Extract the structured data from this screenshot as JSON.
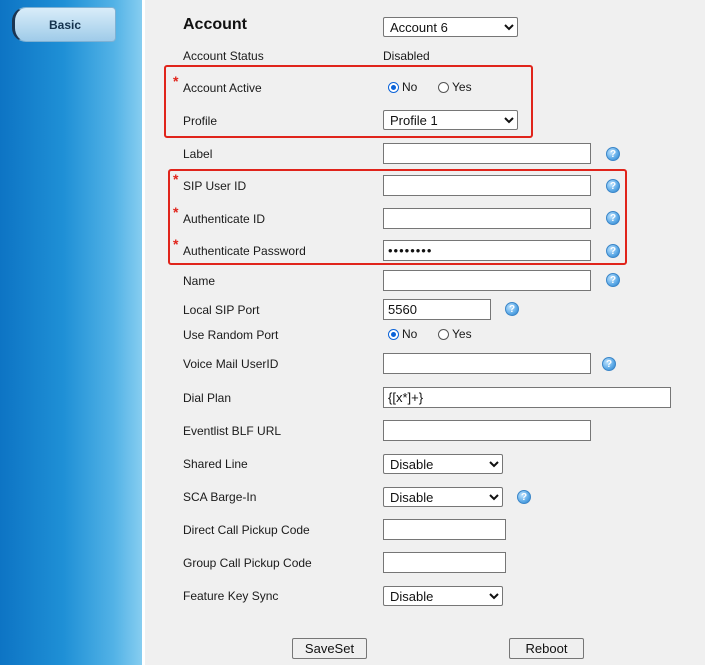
{
  "sidebar": {
    "tab_label": "Basic"
  },
  "form": {
    "title": "Account",
    "account_select": {
      "value": "Account 6",
      "options": [
        "Account 6"
      ]
    },
    "account_status": {
      "label": "Account Status",
      "value": "Disabled"
    },
    "account_active": {
      "label": "Account Active",
      "options": [
        "No",
        "Yes"
      ],
      "selected": "No"
    },
    "profile": {
      "label": "Profile",
      "value": "Profile 1",
      "options": [
        "Profile 1"
      ]
    },
    "label_field": {
      "label": "Label",
      "value": ""
    },
    "sip_user_id": {
      "label": "SIP User ID",
      "value": ""
    },
    "authenticate_id": {
      "label": "Authenticate ID",
      "value": ""
    },
    "authenticate_password": {
      "label": "Authenticate Password",
      "value": "••••••••"
    },
    "name": {
      "label": "Name",
      "value": ""
    },
    "local_sip_port": {
      "label": "Local SIP Port",
      "value": "5560"
    },
    "use_random_port": {
      "label": "Use Random Port",
      "options": [
        "No",
        "Yes"
      ],
      "selected": "No"
    },
    "voice_mail_userid": {
      "label": "Voice Mail UserID",
      "value": ""
    },
    "dial_plan": {
      "label": "Dial Plan",
      "value": "{[x*]+}"
    },
    "eventlist_blf_url": {
      "label": "Eventlist BLF URL",
      "value": ""
    },
    "shared_line": {
      "label": "Shared Line",
      "value": "Disable",
      "options": [
        "Disable"
      ]
    },
    "sca_barge_in": {
      "label": "SCA Barge-In",
      "value": "Disable",
      "options": [
        "Disable"
      ]
    },
    "direct_call_pickup_code": {
      "label": "Direct Call Pickup Code",
      "value": ""
    },
    "group_call_pickup_code": {
      "label": "Group Call Pickup Code",
      "value": ""
    },
    "feature_key_sync": {
      "label": "Feature Key Sync",
      "value": "Disable",
      "options": [
        "Disable"
      ]
    }
  },
  "buttons": {
    "saveset": "SaveSet",
    "reboot": "Reboot"
  },
  "help_icon_glyph": "?",
  "required_marker": "*",
  "colors": {
    "highlight_box": "#e0241b",
    "sidebar": "#1f90d6"
  }
}
